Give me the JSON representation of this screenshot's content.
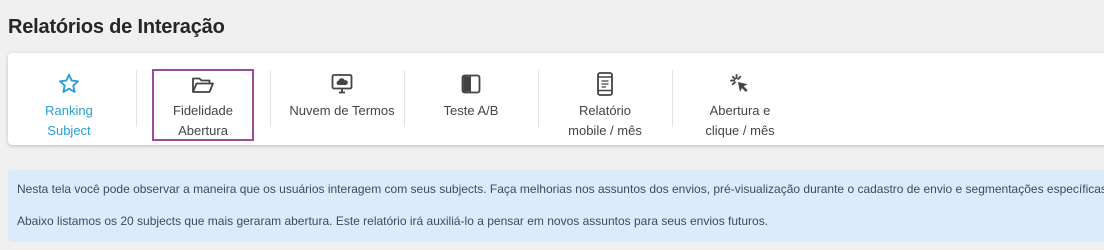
{
  "page": {
    "title": "Relatórios de Interação"
  },
  "tabs": [
    {
      "name": "ranking-subject",
      "icon": "star-icon",
      "line1": "Ranking",
      "line2": "Subject",
      "active": true
    },
    {
      "name": "fidelidade-abertura",
      "icon": "folder-open-icon",
      "line1": "Fidelidade",
      "line2": "Abertura",
      "selected": true
    },
    {
      "name": "nuvem-de-termos",
      "icon": "cloud-monitor-icon",
      "line1": "Nuvem de Termos",
      "line2": ""
    },
    {
      "name": "teste-ab",
      "icon": "split-panel-icon",
      "line1": "Teste A/B",
      "line2": ""
    },
    {
      "name": "relatorio-mobile",
      "icon": "mobile-phone-icon",
      "line1": "Relatório",
      "line2": "mobile / mês"
    },
    {
      "name": "abertura-clique",
      "icon": "cursor-click-icon",
      "line1": "Abertura e",
      "line2": "clique / mês"
    }
  ],
  "info": {
    "line1": "Nesta tela você pode observar a maneira que os usuários interagem com seus subjects. Faça melhorias nos assuntos dos envios, pré-visualização durante o cadastro de envio e segmentações específicas.",
    "line2": "Abaixo listamos os 20 subjects que mais geraram abertura. Este relatório irá auxiliá-lo a pensar em novos assuntos para seus envios futuros."
  },
  "colors": {
    "accent": "#2a9fd8",
    "selected_border": "#9b4a9e",
    "info_bg": "#dcebfb"
  }
}
